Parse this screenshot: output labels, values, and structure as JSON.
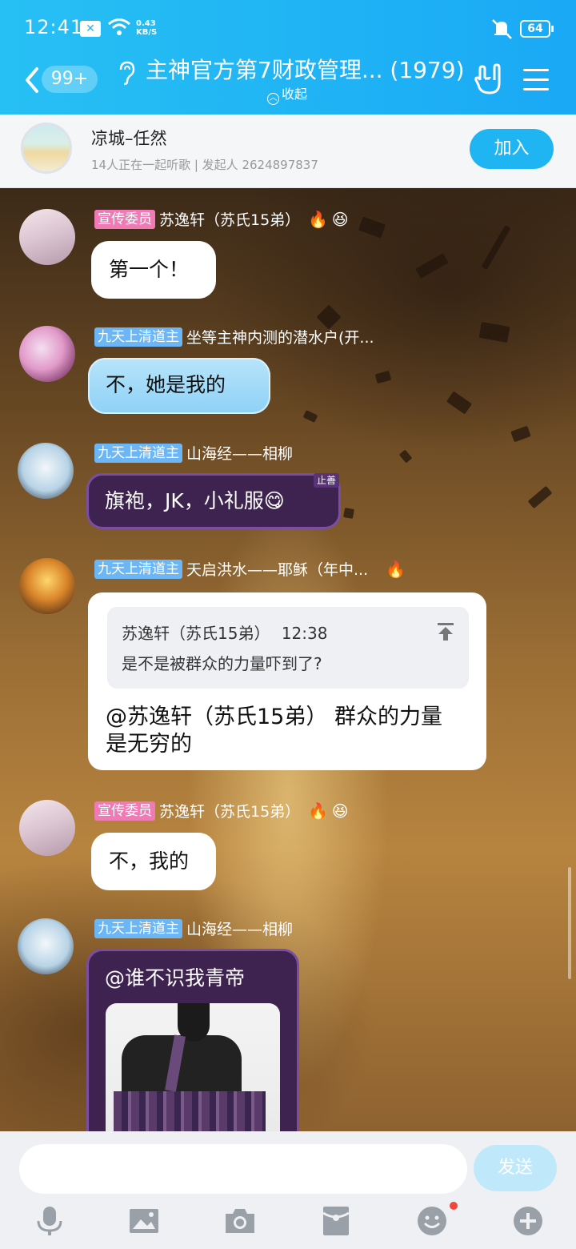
{
  "status_bar": {
    "time": "12:41",
    "speed_value": "0.43",
    "speed_unit": "KB/S",
    "battery": "64"
  },
  "header": {
    "unread_badge": "99+",
    "title": "主神官方第7财政管理... (1979)",
    "collapse_label": "收起"
  },
  "listen_together": {
    "song": "凉城–任然",
    "subtitle": "14人正在一起听歌 | 发起人 2624897837",
    "join_label": "加入"
  },
  "messages": [
    {
      "tag": "宣传委员",
      "sender": "苏逸轩（苏氏15弟）",
      "text": "第一个！"
    },
    {
      "tag": "九天上清道主",
      "sender": "坐等主神内测的潜水户(开...",
      "text": "不，她是我的"
    },
    {
      "tag": "九天上清道主",
      "sender": "山海经——相柳",
      "text": "旗袍，JK，小礼服😋",
      "bubble_badge": "止善"
    },
    {
      "tag": "九天上清道主",
      "sender": "天启洪水——耶稣（年中...",
      "quote": {
        "author": "苏逸轩（苏氏15弟）",
        "time": "12:38",
        "text": "是不是被群众的力量吓到了?"
      },
      "text_line1": "@苏逸轩（苏氏15弟） 群众的力量",
      "text_line2": "是无穷的"
    },
    {
      "tag": "宣传委员",
      "sender": "苏逸轩（苏氏15弟）",
      "text": "不，我的"
    },
    {
      "tag": "九天上清道主",
      "sender": "山海经——相柳",
      "text": "@谁不识我青帝"
    }
  ],
  "input": {
    "send_label": "发送"
  },
  "colors": {
    "header": "#1fb5f2",
    "tag_pink": "#f07ab5",
    "tag_blue": "#6cb6f6",
    "join_button": "#1fb5f2",
    "send_button": "#bfe9fb"
  },
  "icons": [
    "back-icon",
    "ear-icon",
    "rock-hand-icon",
    "menu-icon",
    "pin-top-icon",
    "fire-icon",
    "smile-flower-icon",
    "microphone-icon",
    "image-icon",
    "camera-icon",
    "red-packet-icon",
    "emoji-icon",
    "plus-icon"
  ]
}
